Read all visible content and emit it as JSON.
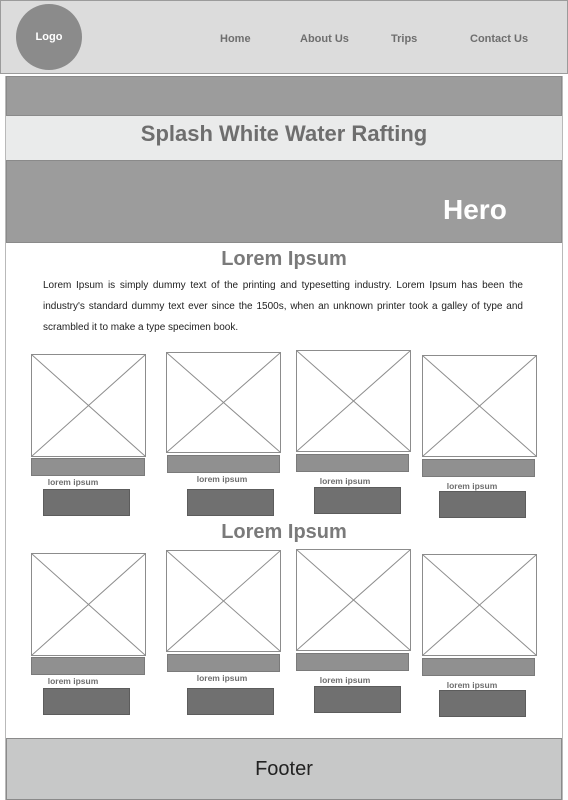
{
  "header": {
    "logo": "Logo",
    "nav": [
      "Home",
      "About Us",
      "Trips",
      "Contact Us"
    ]
  },
  "site_title": "Splash White Water Rafting",
  "hero": {
    "label": "Hero"
  },
  "section1": {
    "title": "Lorem Ipsum",
    "body": "Lorem Ipsum is simply dummy text of the printing and typesetting industry. Lorem Ipsum has been the industry's standard dummy text ever since the 1500s, when an unknown printer took a galley of type and scrambled it to make a type specimen book.",
    "cards": [
      "lorem ipsum",
      "lorem ipsum",
      "lorem ipsum",
      "lorem ipsum"
    ]
  },
  "section2": {
    "title": "Lorem Ipsum",
    "cards": [
      "lorem ipsum",
      "lorem ipsum",
      "lorem ipsum",
      "lorem ipsum"
    ]
  },
  "footer": {
    "label": "Footer"
  },
  "colors": {
    "header_bg": "#dcdcdc",
    "band_gray": "#9c9c9c",
    "title_band": "#eaebeb",
    "button_gray": "#707070",
    "footer_bg": "#c7c8c8"
  }
}
